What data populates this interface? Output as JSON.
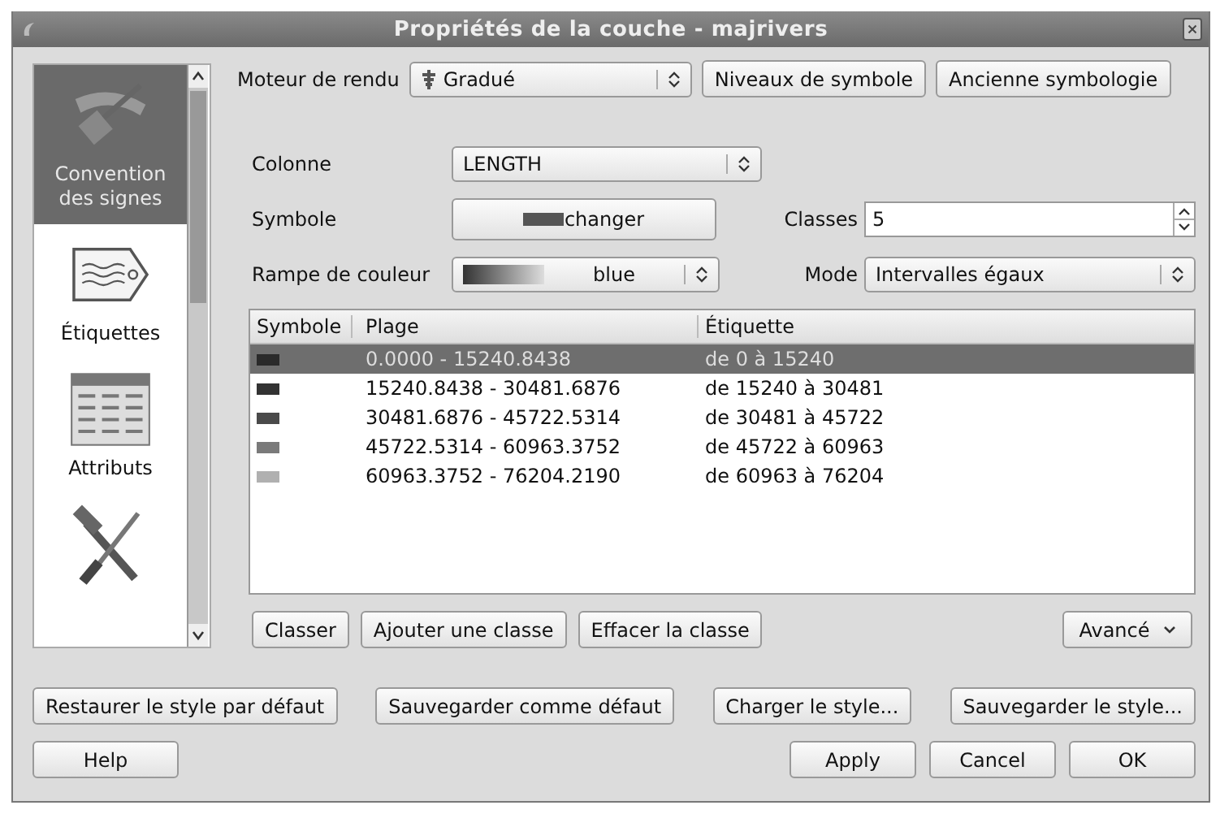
{
  "window": {
    "title": "Propriétés de la couche - majrivers"
  },
  "sidebar": {
    "items": [
      {
        "label": "Convention des signes",
        "selected": true
      },
      {
        "label": "Étiquettes",
        "selected": false
      },
      {
        "label": "Attributs",
        "selected": false
      },
      {
        "selected": false
      }
    ]
  },
  "renderer": {
    "label": "Moteur de rendu",
    "value": "Gradué",
    "buttons": [
      "Niveaux de symbole",
      "Ancienne symbologie"
    ]
  },
  "column": {
    "label": "Colonne",
    "value": "LENGTH"
  },
  "symbol": {
    "label": "Symbole",
    "button": "changer"
  },
  "classes": {
    "label": "Classes",
    "value": "5"
  },
  "color_ramp": {
    "label": "Rampe de couleur",
    "value": "blue"
  },
  "mode": {
    "label": "Mode",
    "value": "Intervalles égaux"
  },
  "table": {
    "columns": [
      "Symbole",
      "Plage",
      "Étiquette"
    ],
    "rows": [
      {
        "range": "0.0000 - 15240.8438",
        "label": "de 0 à 15240",
        "color": "#2a2a2a",
        "selected": true
      },
      {
        "range": "15240.8438 - 30481.6876",
        "label": "de 15240 à 30481",
        "color": "#333333",
        "selected": false
      },
      {
        "range": "30481.6876 - 45722.5314",
        "label": "de 30481 à 45722",
        "color": "#4a4a4a",
        "selected": false
      },
      {
        "range": "45722.5314 - 60963.3752",
        "label": "de 45722 à 60963",
        "color": "#7a7a7a",
        "selected": false
      },
      {
        "range": "60963.3752 - 76204.2190",
        "label": "de 60963 à 76204",
        "color": "#b0b0b0",
        "selected": false
      }
    ]
  },
  "table_buttons": [
    "Classer",
    "Ajouter une classe",
    "Effacer la classe"
  ],
  "advanced": {
    "label": "Avancé"
  },
  "style_buttons": [
    "Restaurer le style par défaut",
    "Sauvegarder comme défaut",
    "Charger le style...",
    "Sauvegarder le style..."
  ],
  "dialog_buttons": {
    "help": "Help",
    "actions": [
      "Apply",
      "Cancel",
      "OK"
    ]
  }
}
